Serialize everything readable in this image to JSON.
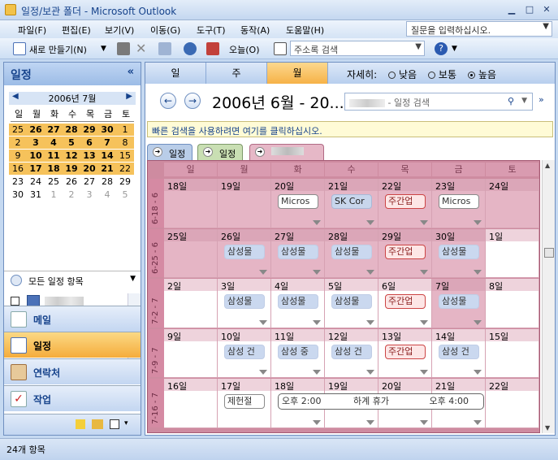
{
  "window": {
    "title": "일정/보관 폴더 - Microsoft Outlook"
  },
  "menu": {
    "items": [
      "파일(F)",
      "편집(E)",
      "보기(V)",
      "이동(G)",
      "도구(T)",
      "동작(A)",
      "도움말(H)"
    ],
    "help_placeholder": "질문을 입력하십시오."
  },
  "toolbar": {
    "new_label": "새로 만들기(N)",
    "today_label": "오늘(O)",
    "addressbook_placeholder": "주소록 검색"
  },
  "nav": {
    "title": "일정",
    "collapse": "«",
    "mini_calendar": {
      "month_label": "2006년 7월",
      "weekday_headers": [
        "일",
        "월",
        "화",
        "수",
        "목",
        "금",
        "토"
      ],
      "weeks": [
        [
          "25",
          "26",
          "27",
          "28",
          "29",
          "30",
          "1"
        ],
        [
          "2",
          "3",
          "4",
          "5",
          "6",
          "7",
          "8"
        ],
        [
          "9",
          "10",
          "11",
          "12",
          "13",
          "14",
          "15"
        ],
        [
          "16",
          "17",
          "18",
          "19",
          "20",
          "21",
          "22"
        ],
        [
          "23",
          "24",
          "25",
          "26",
          "27",
          "28",
          "29"
        ],
        [
          "30",
          "31",
          "1",
          "2",
          "3",
          "4",
          "5"
        ]
      ]
    },
    "all_calendars_label": "모든 일정 항목",
    "buttons": [
      {
        "label": "메일"
      },
      {
        "label": "일정"
      },
      {
        "label": "연락처"
      },
      {
        "label": "작업"
      }
    ]
  },
  "view": {
    "tabs": [
      "일",
      "주",
      "월"
    ],
    "selected_tab": "월",
    "detail_label": "자세히:",
    "detail_options": [
      "낮음",
      "보통",
      "높음"
    ],
    "detail_selected": "높음",
    "range_title": "2006년 6월 - 20...",
    "search_placeholder": "- 일정 검색",
    "quick_bar": "빠른 검색을 사용하려면 여기를 클릭하십시오.",
    "cal_tabs": [
      "일정",
      "일정"
    ],
    "weekday_headers": [
      "일",
      "월",
      "화",
      "수",
      "목",
      "금",
      "토"
    ],
    "weeks": [
      {
        "label": "6-18 - 6",
        "days": [
          "18일",
          "19일",
          "20일",
          "21일",
          "22일",
          "23일",
          "24일"
        ]
      },
      {
        "label": "6-25 - 6",
        "days": [
          "25일",
          "26일",
          "27일",
          "28일",
          "29일",
          "30일",
          "1일"
        ]
      },
      {
        "label": "7-2 - 7",
        "days": [
          "2일",
          "3일",
          "4일",
          "5일",
          "6일",
          "7일",
          "8일"
        ]
      },
      {
        "label": "7-9 - 7",
        "days": [
          "9일",
          "10일",
          "11일",
          "12일",
          "13일",
          "14일",
          "15일"
        ]
      },
      {
        "label": "7-16 - 7",
        "days": [
          "16일",
          "17일",
          "18일",
          "19일",
          "20일",
          "21일",
          "22일"
        ]
      }
    ],
    "appointments": {
      "w0": [
        "",
        "",
        "Micros",
        "SK Cor",
        "주간업",
        "Micros",
        ""
      ],
      "w1": [
        "",
        "삼성물",
        "삼성물",
        "삼성물",
        "주간업",
        "삼성물",
        ""
      ],
      "w2": [
        "",
        "삼성물",
        "삼성물",
        "삼성물",
        "주간업",
        "삼성물",
        ""
      ],
      "w3": [
        "",
        "삼성 건",
        "삼성 중",
        "삼성 건",
        "주간업",
        "삼성 건",
        ""
      ],
      "w4": [
        "",
        "제헌절",
        "",
        "",
        "",
        "",
        ""
      ]
    },
    "multiday_event": {
      "start": "오후 2:00",
      "title": "하계 휴가",
      "end": "오후 4:00"
    }
  },
  "status": {
    "items_label": "24개 항목"
  }
}
